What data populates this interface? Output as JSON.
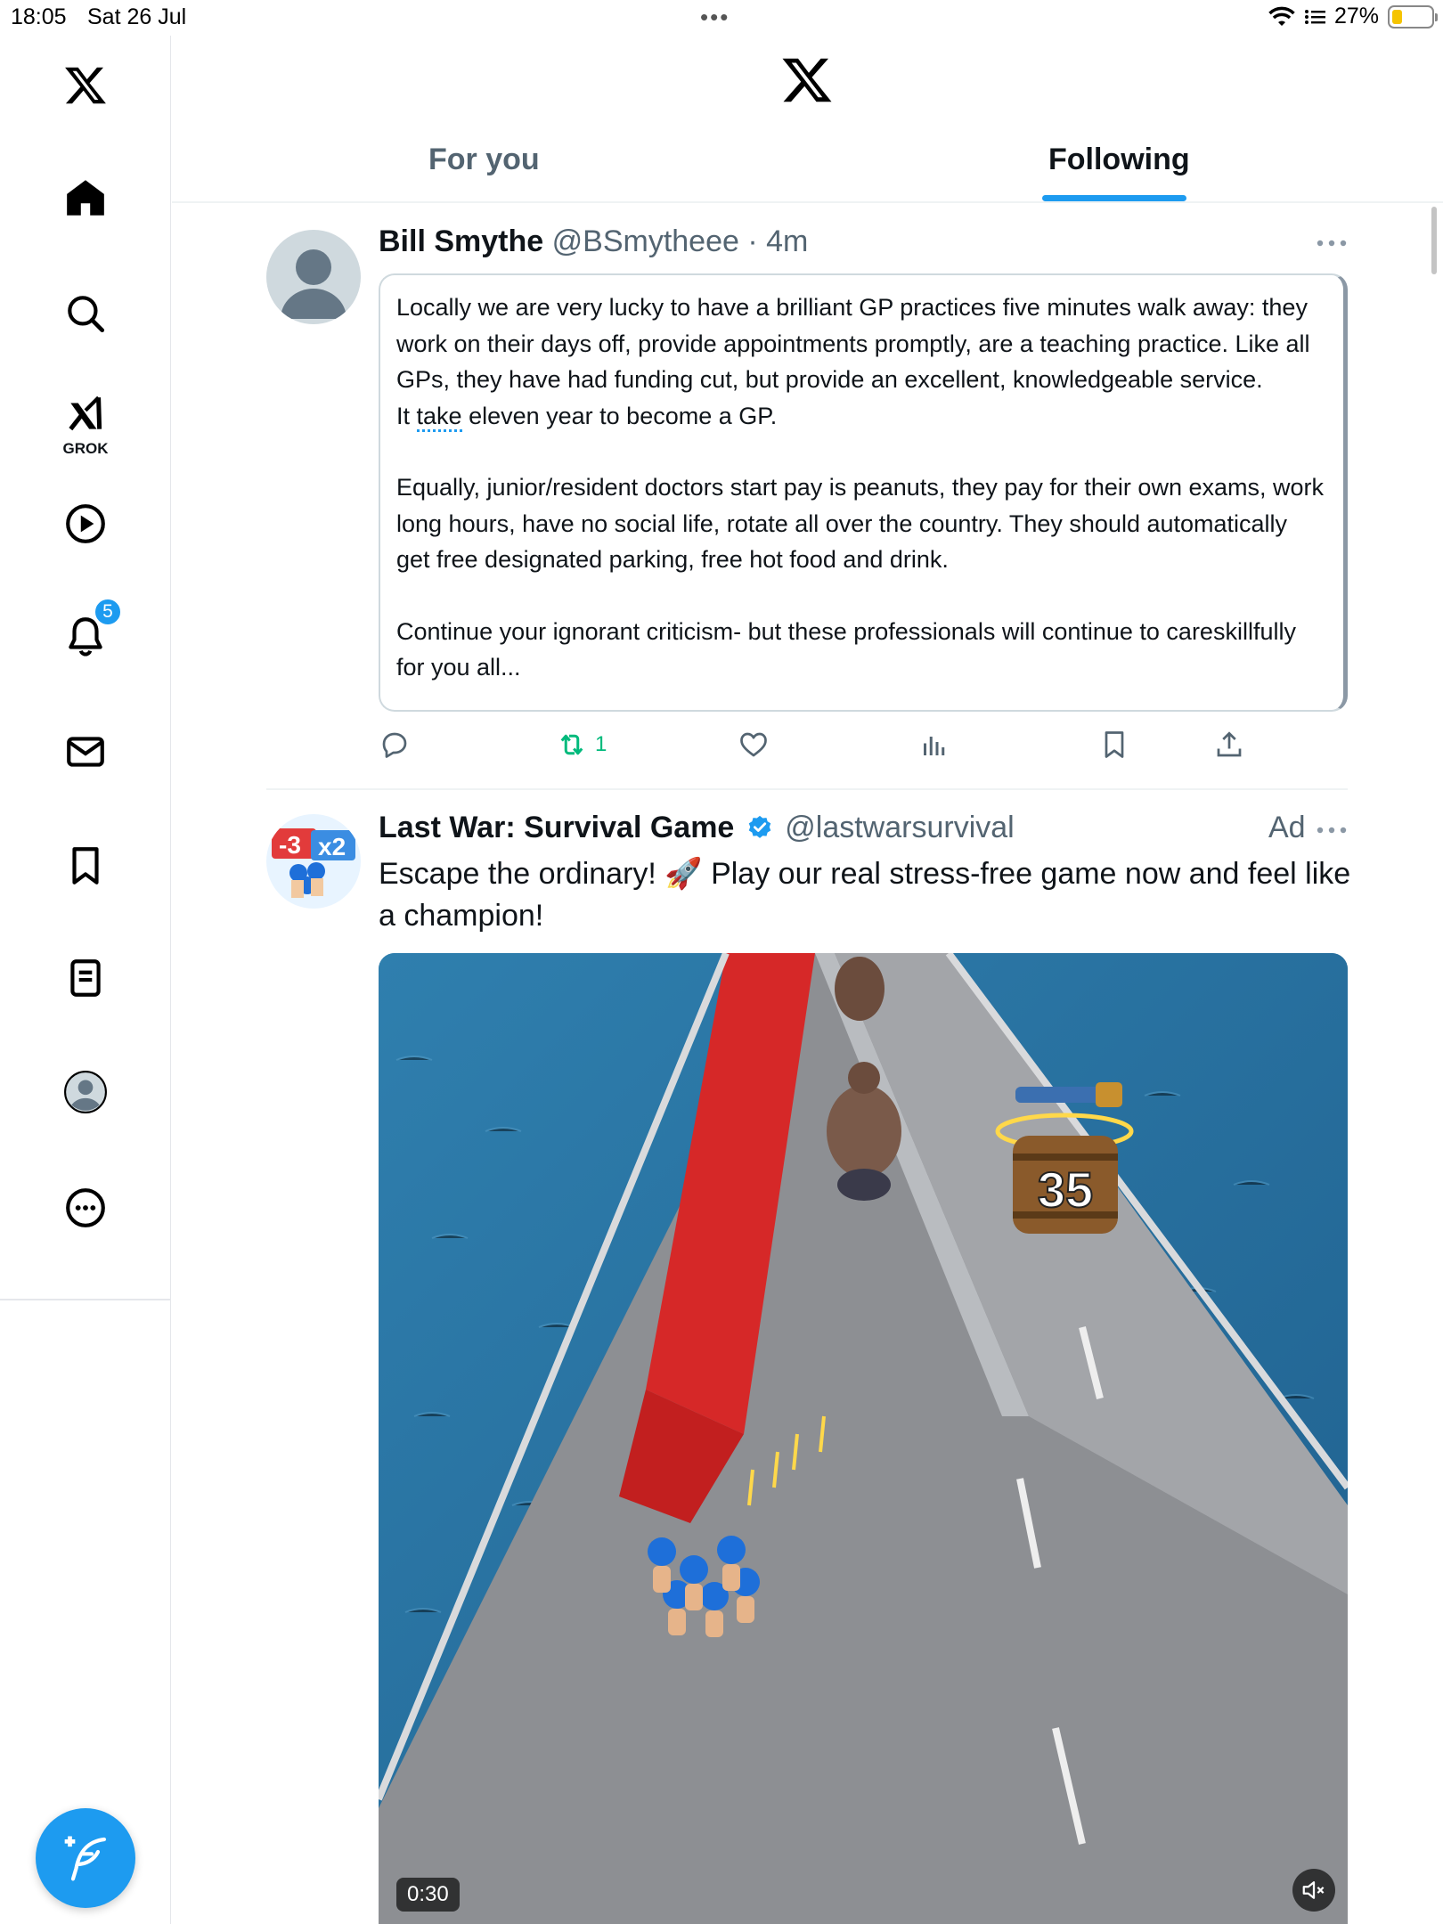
{
  "status_bar": {
    "time": "18:05",
    "date": "Sat 26 Jul",
    "battery": "27%",
    "battery_level": 0.27
  },
  "sidebar": {
    "items": [
      {
        "icon": "home-icon"
      },
      {
        "icon": "search-icon"
      },
      {
        "icon": "grok-icon",
        "label": "GROK"
      },
      {
        "icon": "video-icon"
      },
      {
        "icon": "bell-icon",
        "badge": "5"
      },
      {
        "icon": "mail-icon"
      },
      {
        "icon": "bookmark-icon"
      },
      {
        "icon": "lists-icon"
      },
      {
        "icon": "profile-avatar-icon"
      },
      {
        "icon": "more-circle-icon"
      }
    ],
    "compose_icon": "compose-feather-icon"
  },
  "header": {
    "tabs": [
      {
        "label": "For you",
        "active": false
      },
      {
        "label": "Following",
        "active": true
      }
    ],
    "accent": "#1d9bf0"
  },
  "tweets": [
    {
      "name": "Bill Smythe",
      "handle": "@BSmytheee",
      "time": "4m",
      "quote_paragraphs": [
        {
          "before": "Locally we are very lucky to have a brilliant GP practices five minutes walk away: they work on their days off, provide appointments promptly, are a teaching practice. Like all GPs, they have had funding cut, but provide an excellent, knowledgeable service.",
          "line2_pre": "It ",
          "line2_u": "take",
          "line2_post": " eleven year to become a GP."
        },
        {
          "text": "Equally, junior/resident doctors start pay is peanuts, they pay for their own exams, work long hours, have no social life, rotate all over the country. They should automatically get free designated parking, free hot food and drink."
        },
        {
          "text": "Continue your ignorant criticism- but these professionals will continue to careskillfully for you all..."
        }
      ],
      "retweet_count": "1",
      "retweet_color": "#00ba7c"
    },
    {
      "name": "Last War: Survival Game",
      "handle": "@lastwarsurvival",
      "ad_label": "Ad",
      "verified": true,
      "text": "Escape the ordinary! 🚀 Play our real stress-free game now and feel like a champion!",
      "video_duration": "0:30",
      "barrel_number": "35",
      "avatar_badges": [
        "-3",
        "x2"
      ]
    }
  ]
}
